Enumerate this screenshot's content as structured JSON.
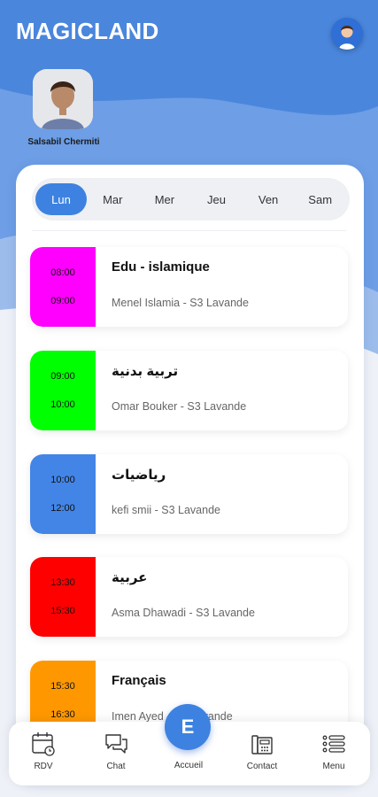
{
  "header": {
    "app_title": "MAGICLAND",
    "student_name": "Salsabil Chermiti"
  },
  "days": {
    "items": [
      "Lun",
      "Mar",
      "Mer",
      "Jeu",
      "Ven",
      "Sam"
    ],
    "selected": "Lun"
  },
  "schedule": [
    {
      "start": "08:00",
      "end": "09:00",
      "subject": "Edu - islamique",
      "teacher": "Menel Islamia - S3 Lavande",
      "color": "#ff00ff"
    },
    {
      "start": "09:00",
      "end": "10:00",
      "subject": "تربية بدنية",
      "teacher": "Omar Bouker - S3 Lavande",
      "color": "#00ff00"
    },
    {
      "start": "10:00",
      "end": "12:00",
      "subject": "رياضيات",
      "teacher": "kefi smii - S3 Lavande",
      "color": "#4285e6"
    },
    {
      "start": "13:30",
      "end": "15:30",
      "subject": "عربية",
      "teacher": "Asma Dhawadi - S3 Lavande",
      "color": "#ff0000"
    },
    {
      "start": "15:30",
      "end": "16:30",
      "subject": "Français",
      "teacher": "Imen Ayed - S3 Lavande",
      "color": "#ff9800"
    }
  ],
  "nav": {
    "rdv": "RDV",
    "chat": "Chat",
    "home": "Accueil",
    "home_letter": "E",
    "contact": "Contact",
    "menu": "Menu"
  },
  "colors": {
    "accent": "#3d82e0",
    "header_bg": "#4a86dc"
  }
}
